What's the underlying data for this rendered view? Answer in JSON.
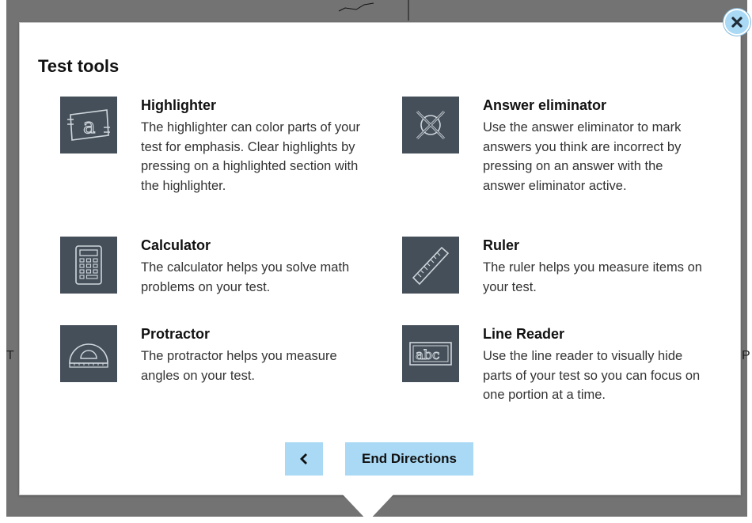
{
  "edge_text": {
    "left": "T",
    "right": "P"
  },
  "dialog": {
    "title": "Test tools",
    "tools": [
      {
        "icon": "highlighter-icon",
        "name": "Highlighter",
        "description": "The highlighter can color parts of your test for emphasis. Clear highlights by pressing on a highlighted section with the highlighter."
      },
      {
        "icon": "answer-eliminator-icon",
        "name": "Answer eliminator",
        "description": "Use the answer eliminator to mark answers you think are incorrect by pressing on an answer with the answer eliminator active."
      },
      {
        "icon": "calculator-icon",
        "name": "Calculator",
        "description": "The calculator helps you solve math problems on your test."
      },
      {
        "icon": "ruler-icon",
        "name": "Ruler",
        "description": "The ruler helps you measure items on your test."
      },
      {
        "icon": "protractor-icon",
        "name": "Protractor",
        "description": "The protractor helps you measure angles on your test."
      },
      {
        "icon": "line-reader-icon",
        "name": "Line Reader",
        "description": "Use the line reader to visually hide parts of your test so you can focus on one portion at a time."
      }
    ],
    "buttons": {
      "back_icon": "chevron-left-icon",
      "end_directions": "End Directions"
    },
    "close_icon": "close-icon"
  },
  "colors": {
    "icon_tile": "#454f59",
    "button": "#a9d9f5",
    "backdrop": "#737373"
  }
}
